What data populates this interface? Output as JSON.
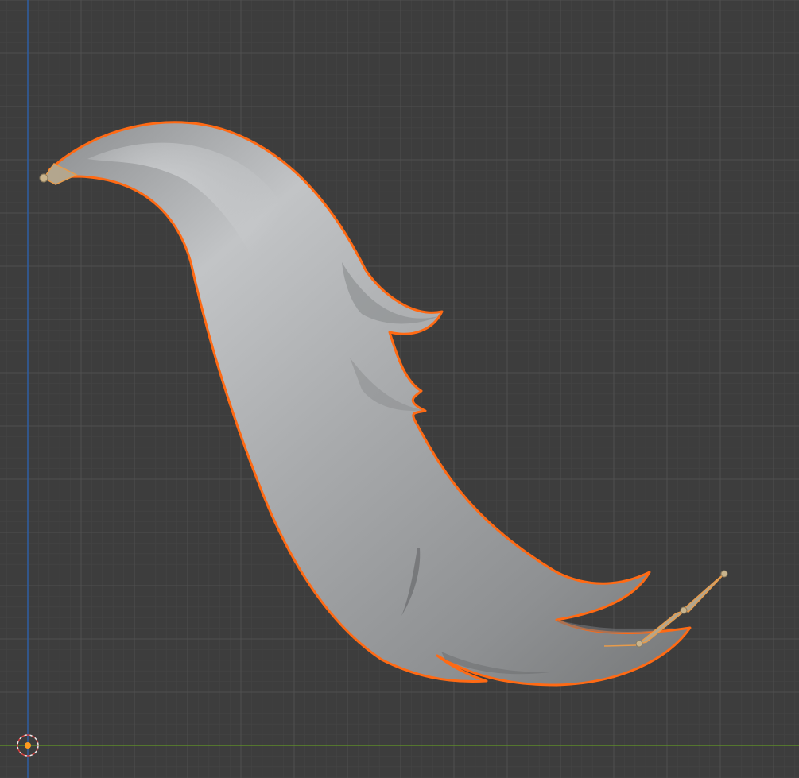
{
  "viewport": {
    "background_color": "#3d3d3d",
    "grid_minor_color": "#454545",
    "grid_major_color": "#505050",
    "x_axis_color": "#5d8a2a",
    "z_axis_color": "#2f5ea3"
  },
  "object": {
    "body_color": "#a6a7a8",
    "highlight_color": "#c4c6c8",
    "shadow_color": "#7e8082",
    "selection_outline_color": "#ff6a14"
  },
  "bones": {
    "color": "#b3a68e",
    "outline_color": "#e79b4b",
    "joint_color": "#c9b48d"
  },
  "icons": {
    "origin": "3d-cursor-icon"
  }
}
